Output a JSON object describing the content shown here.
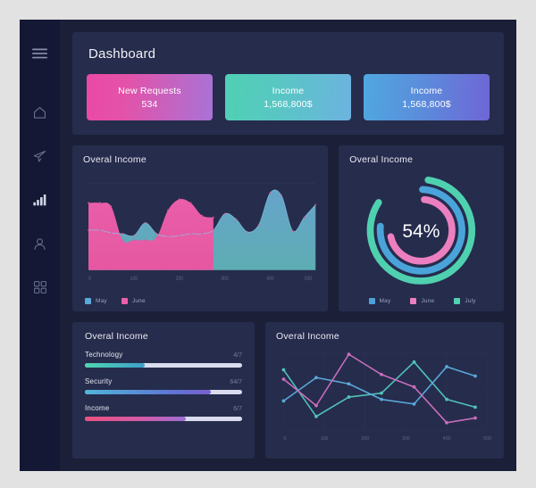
{
  "app": {
    "background": "#e2e2e2",
    "frame_bg": "#1b2038",
    "panel_bg": "#262c4c",
    "sidebar_bg": "#141834"
  },
  "sidebar": {
    "items": [
      {
        "name": "menu-icon",
        "label": "Menu",
        "active": false
      },
      {
        "name": "home-icon",
        "label": "Home",
        "active": false
      },
      {
        "name": "send-icon",
        "label": "Messages",
        "active": false
      },
      {
        "name": "bar-chart-icon",
        "label": "Analytics",
        "active": true
      },
      {
        "name": "user-icon",
        "label": "Profile",
        "active": false
      },
      {
        "name": "grid-icon",
        "label": "Apps",
        "active": false
      }
    ]
  },
  "header": {
    "title": "Dashboard",
    "cards": [
      {
        "title": "New Requests",
        "value": "534",
        "gradient": [
          "#ea49a5",
          "#a873d6"
        ]
      },
      {
        "title": "Income",
        "value": "1,568,800$",
        "gradient": [
          "#4fd1b4",
          "#6cb3e0"
        ]
      },
      {
        "title": "Income",
        "value": "1,568,800$",
        "gradient": [
          "#4fa8e0",
          "#6f66d6"
        ]
      }
    ]
  },
  "panels": {
    "area": {
      "title": "Overal Income"
    },
    "donut": {
      "title": "Overal Income"
    },
    "bars": {
      "title": "Overal Income"
    },
    "lines": {
      "title": "Overal Income"
    }
  },
  "progress": {
    "items": [
      {
        "label": "Technology",
        "count": "4/7",
        "percent": 38
      },
      {
        "label": "Security",
        "count": "64/7",
        "percent": 80
      },
      {
        "label": "Income",
        "count": "6/7",
        "percent": 64
      }
    ]
  },
  "chart_data": [
    {
      "id": "area-chart",
      "type": "area",
      "title": "Overal Income",
      "xlabel": "",
      "ylabel": "",
      "xticks": [
        "0",
        "100",
        "200",
        "300",
        "400",
        "500"
      ],
      "xlim": [
        0,
        500
      ],
      "ylim": [
        0,
        100
      ],
      "grid": false,
      "legend_position": "bottom-left",
      "series": [
        {
          "name": "May",
          "color": "#5aa9d6",
          "x": [
            0,
            25,
            50,
            75,
            100,
            125,
            150,
            175,
            200,
            225,
            250,
            275,
            300,
            325,
            350,
            375,
            400,
            425,
            450,
            475,
            500
          ],
          "values": [
            44,
            44,
            41,
            40,
            38,
            52,
            40,
            37,
            38,
            40,
            40,
            44,
            62,
            56,
            42,
            50,
            85,
            82,
            43,
            58,
            72
          ]
        },
        {
          "name": "June",
          "color": "#ec5fab",
          "x": [
            0,
            25,
            50,
            75,
            100,
            125,
            150,
            175,
            200,
            225,
            250,
            275,
            300,
            325,
            350,
            375,
            400,
            425,
            450,
            475,
            500
          ],
          "values": [
            74,
            74,
            70,
            33,
            33,
            33,
            36,
            66,
            78,
            74,
            60,
            58,
            0,
            0,
            0,
            0,
            0,
            0,
            0,
            0,
            0
          ]
        }
      ],
      "legend": [
        {
          "label": "May",
          "color": "#5aa9d6"
        },
        {
          "label": "June",
          "color": "#ec5fab"
        }
      ]
    },
    {
      "id": "donut-chart",
      "type": "pie",
      "title": "Overal Income",
      "center_label": "54%",
      "grid": false,
      "legend_position": "bottom-center",
      "rings": [
        {
          "name": "July",
          "color": "#4fd1b0",
          "percent": 82,
          "radius": 46
        },
        {
          "name": "May",
          "color": "#4aa3d9",
          "percent": 76,
          "radius": 37
        },
        {
          "name": "June",
          "color": "#ec7fc0",
          "percent": 70,
          "radius": 28
        }
      ],
      "legend": [
        {
          "label": "May",
          "color": "#4aa3d9"
        },
        {
          "label": "June",
          "color": "#ec7fc0"
        },
        {
          "label": "July",
          "color": "#4fd1b0"
        }
      ]
    },
    {
      "id": "progress-chart",
      "type": "table",
      "title": "Overal Income",
      "categories": [
        "Technology",
        "Security",
        "Income"
      ],
      "labels": [
        "4/7",
        "64/7",
        "6/7"
      ],
      "values": [
        38,
        80,
        64
      ],
      "ylim": [
        0,
        100
      ]
    },
    {
      "id": "line-chart",
      "type": "line",
      "title": "Overal Income",
      "xticks": [
        "0",
        "100",
        "200",
        "300",
        "400",
        "500"
      ],
      "xlim": [
        0,
        500
      ],
      "ylim": [
        0,
        100
      ],
      "grid": true,
      "legend_position": "none",
      "series": [
        {
          "name": "series-teal",
          "color": "#4fc3b8",
          "x": [
            0,
            80,
            160,
            240,
            320,
            400,
            470
          ],
          "values": [
            78,
            18,
            43,
            48,
            88,
            40,
            30
          ]
        },
        {
          "name": "series-blue",
          "color": "#59a8d8",
          "x": [
            0,
            80,
            160,
            240,
            320,
            400,
            470
          ],
          "values": [
            38,
            68,
            60,
            40,
            34,
            82,
            70
          ]
        },
        {
          "name": "series-pink",
          "color": "#c76dbb",
          "x": [
            0,
            80,
            160,
            240,
            320,
            400,
            470
          ],
          "values": [
            66,
            32,
            98,
            72,
            56,
            10,
            16
          ]
        }
      ]
    }
  ]
}
